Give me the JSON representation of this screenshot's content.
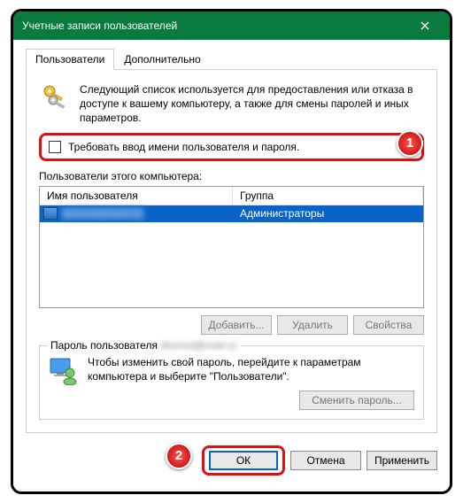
{
  "window": {
    "title": "Учетные записи пользователей"
  },
  "tabs": {
    "users": "Пользователи",
    "advanced": "Дополнительно"
  },
  "intro": "Следующий список используется для предоставления или отказа в доступе к вашему компьютеру, а также для смены паролей и иных параметров.",
  "checkbox": {
    "label": "Требовать ввод имени пользователя и пароля."
  },
  "users_section": {
    "label": "Пользователи этого компьютера:",
    "columns": {
      "username": "Имя пользователя",
      "group": "Группа"
    },
    "row": {
      "username": "blurred@mail.ru",
      "group": "Администраторы"
    }
  },
  "buttons": {
    "add": "Добавить...",
    "remove": "Удалить",
    "properties": "Свойства"
  },
  "password_section": {
    "legend_prefix": "Пароль пользователя",
    "legend_user": "blurred@mail.ru",
    "text": "Чтобы изменить свой пароль, перейдите к параметрам компьютера и выберите \"Пользователи\".",
    "change_btn": "Сменить пароль..."
  },
  "dialog_buttons": {
    "ok": "ОК",
    "cancel": "Отмена",
    "apply": "Применить"
  },
  "badges": {
    "one": "1",
    "two": "2"
  }
}
